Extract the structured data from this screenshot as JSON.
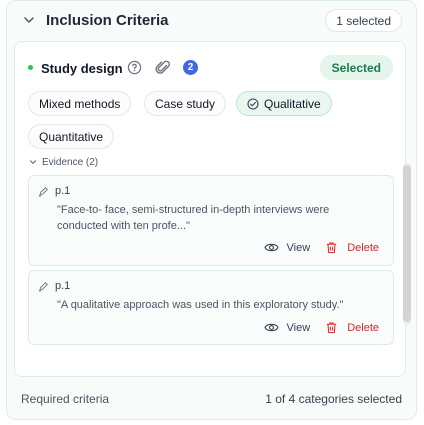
{
  "header": {
    "title": "Inclusion Criteria",
    "count": "1 selected"
  },
  "criteria": {
    "label": "Study design",
    "badge": "2",
    "status": "Selected",
    "options": [
      {
        "label": "Mixed methods",
        "selected": false
      },
      {
        "label": "Case study",
        "selected": false
      },
      {
        "label": "Qualitative",
        "selected": true
      },
      {
        "label": "Quantitative",
        "selected": false
      }
    ],
    "evidence_label": "Evidence (2)",
    "evidence": [
      {
        "page": "p.1",
        "quote": "\"Face-to- face, semi-structured in-depth interviews were conducted with ten profe...\"",
        "view": "View",
        "delete": "Delete"
      },
      {
        "page": "p.1",
        "quote": "\"A qualitative approach was used in this exploratory study.\"",
        "view": "View",
        "delete": "Delete"
      }
    ]
  },
  "footer": {
    "left": "Required criteria",
    "right": "1 of 4 categories selected"
  },
  "colors": {
    "accent": "#22c55e",
    "badge": "#4169e1",
    "delete": "#dc2626",
    "selected_bg": "#e4f5ec"
  },
  "icons": [
    "chevron-down-icon",
    "help-circle-icon",
    "paperclip-icon",
    "check-circle-icon",
    "highlighter-icon",
    "eye-icon",
    "trash-icon"
  ]
}
